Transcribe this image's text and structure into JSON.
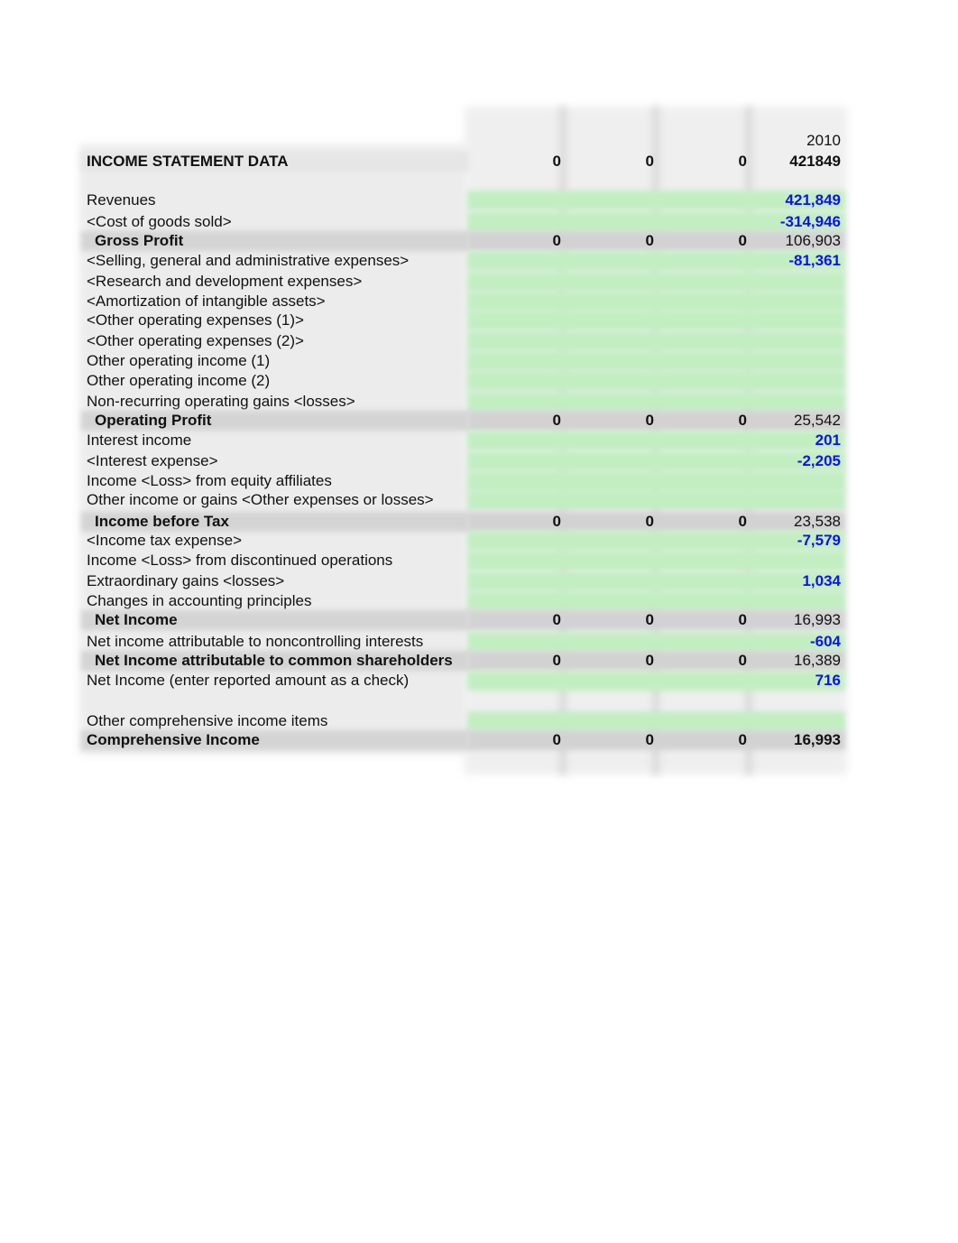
{
  "sheet": {
    "title": "INCOME STATEMENT DATA",
    "year_headers": [
      "",
      "",
      "",
      "2010"
    ],
    "header_values": [
      "0",
      "0",
      "0",
      "421849"
    ],
    "colors": {
      "input_fill": "#c2eec2",
      "total_fill": "#d2d2d2",
      "input_text": "#1010ee",
      "text": "#111111"
    },
    "rows": [
      {
        "label": "Revenues",
        "type": "input",
        "values": [
          "",
          "",
          "",
          "421,849"
        ]
      },
      {
        "label": "<Cost of goods sold>",
        "type": "input",
        "values": [
          "",
          "",
          "",
          "-314,946"
        ]
      },
      {
        "label": "Gross Profit",
        "type": "total",
        "values": [
          "0",
          "0",
          "0",
          "106,903"
        ]
      },
      {
        "label": "<Selling, general and administrative expenses>",
        "type": "input",
        "values": [
          "",
          "",
          "",
          "-81,361"
        ]
      },
      {
        "label": "<Research and development expenses>",
        "type": "input",
        "values": [
          "",
          "",
          "",
          ""
        ]
      },
      {
        "label": "<Amortization of intangible assets>",
        "type": "input",
        "values": [
          "",
          "",
          "",
          ""
        ]
      },
      {
        "label": "<Other operating expenses (1)>",
        "type": "input",
        "values": [
          "",
          "",
          "",
          ""
        ]
      },
      {
        "label": "<Other operating expenses (2)>",
        "type": "input",
        "values": [
          "",
          "",
          "",
          ""
        ]
      },
      {
        "label": "Other operating income (1)",
        "type": "input",
        "values": [
          "",
          "",
          "",
          ""
        ]
      },
      {
        "label": "Other operating income (2)",
        "type": "input",
        "values": [
          "",
          "",
          "",
          ""
        ]
      },
      {
        "label": "Non-recurring operating gains <losses>",
        "type": "input",
        "values": [
          "",
          "",
          "",
          ""
        ]
      },
      {
        "label": "Operating Profit",
        "type": "total",
        "values": [
          "0",
          "0",
          "0",
          "25,542"
        ]
      },
      {
        "label": "Interest income",
        "type": "input",
        "values": [
          "",
          "",
          "",
          "201"
        ]
      },
      {
        "label": "<Interest expense>",
        "type": "input",
        "values": [
          "",
          "",
          "",
          "-2,205"
        ]
      },
      {
        "label": "Income <Loss> from equity affiliates",
        "type": "input",
        "values": [
          "",
          "",
          "",
          ""
        ]
      },
      {
        "label": "Other income or gains <Other expenses or losses>",
        "type": "input",
        "values": [
          "",
          "",
          "",
          ""
        ]
      },
      {
        "label": "Income before Tax",
        "type": "total",
        "values": [
          "0",
          "0",
          "0",
          "23,538"
        ]
      },
      {
        "label": "<Income tax expense>",
        "type": "input",
        "values": [
          "",
          "",
          "",
          "-7,579"
        ]
      },
      {
        "label": "Income <Loss> from discontinued operations",
        "type": "input",
        "values": [
          "",
          "",
          "",
          ""
        ]
      },
      {
        "label": "Extraordinary gains <losses>",
        "type": "input",
        "values": [
          "",
          "",
          "",
          "1,034"
        ]
      },
      {
        "label": "Changes in accounting principles",
        "type": "input",
        "values": [
          "",
          "",
          "",
          ""
        ]
      },
      {
        "label": "Net Income",
        "type": "total",
        "values": [
          "0",
          "0",
          "0",
          "16,993"
        ]
      },
      {
        "label": "Net income attributable to noncontrolling interests",
        "type": "input",
        "values": [
          "",
          "",
          "",
          "-604"
        ]
      },
      {
        "label": "Net Income attributable to common shareholders",
        "type": "total",
        "values": [
          "0",
          "0",
          "0",
          "16,389"
        ]
      },
      {
        "label": "Net Income (enter reported amount as a check)",
        "type": "input",
        "values": [
          "",
          "",
          "",
          "716"
        ]
      },
      {
        "label": "",
        "type": "blank",
        "values": [
          "",
          "",
          "",
          ""
        ]
      },
      {
        "label": "Other comprehensive income items",
        "type": "input",
        "values": [
          "",
          "",
          "",
          ""
        ]
      },
      {
        "label": "Comprehensive Income",
        "type": "grand",
        "values": [
          "0",
          "0",
          "0",
          "16,993"
        ]
      }
    ]
  }
}
